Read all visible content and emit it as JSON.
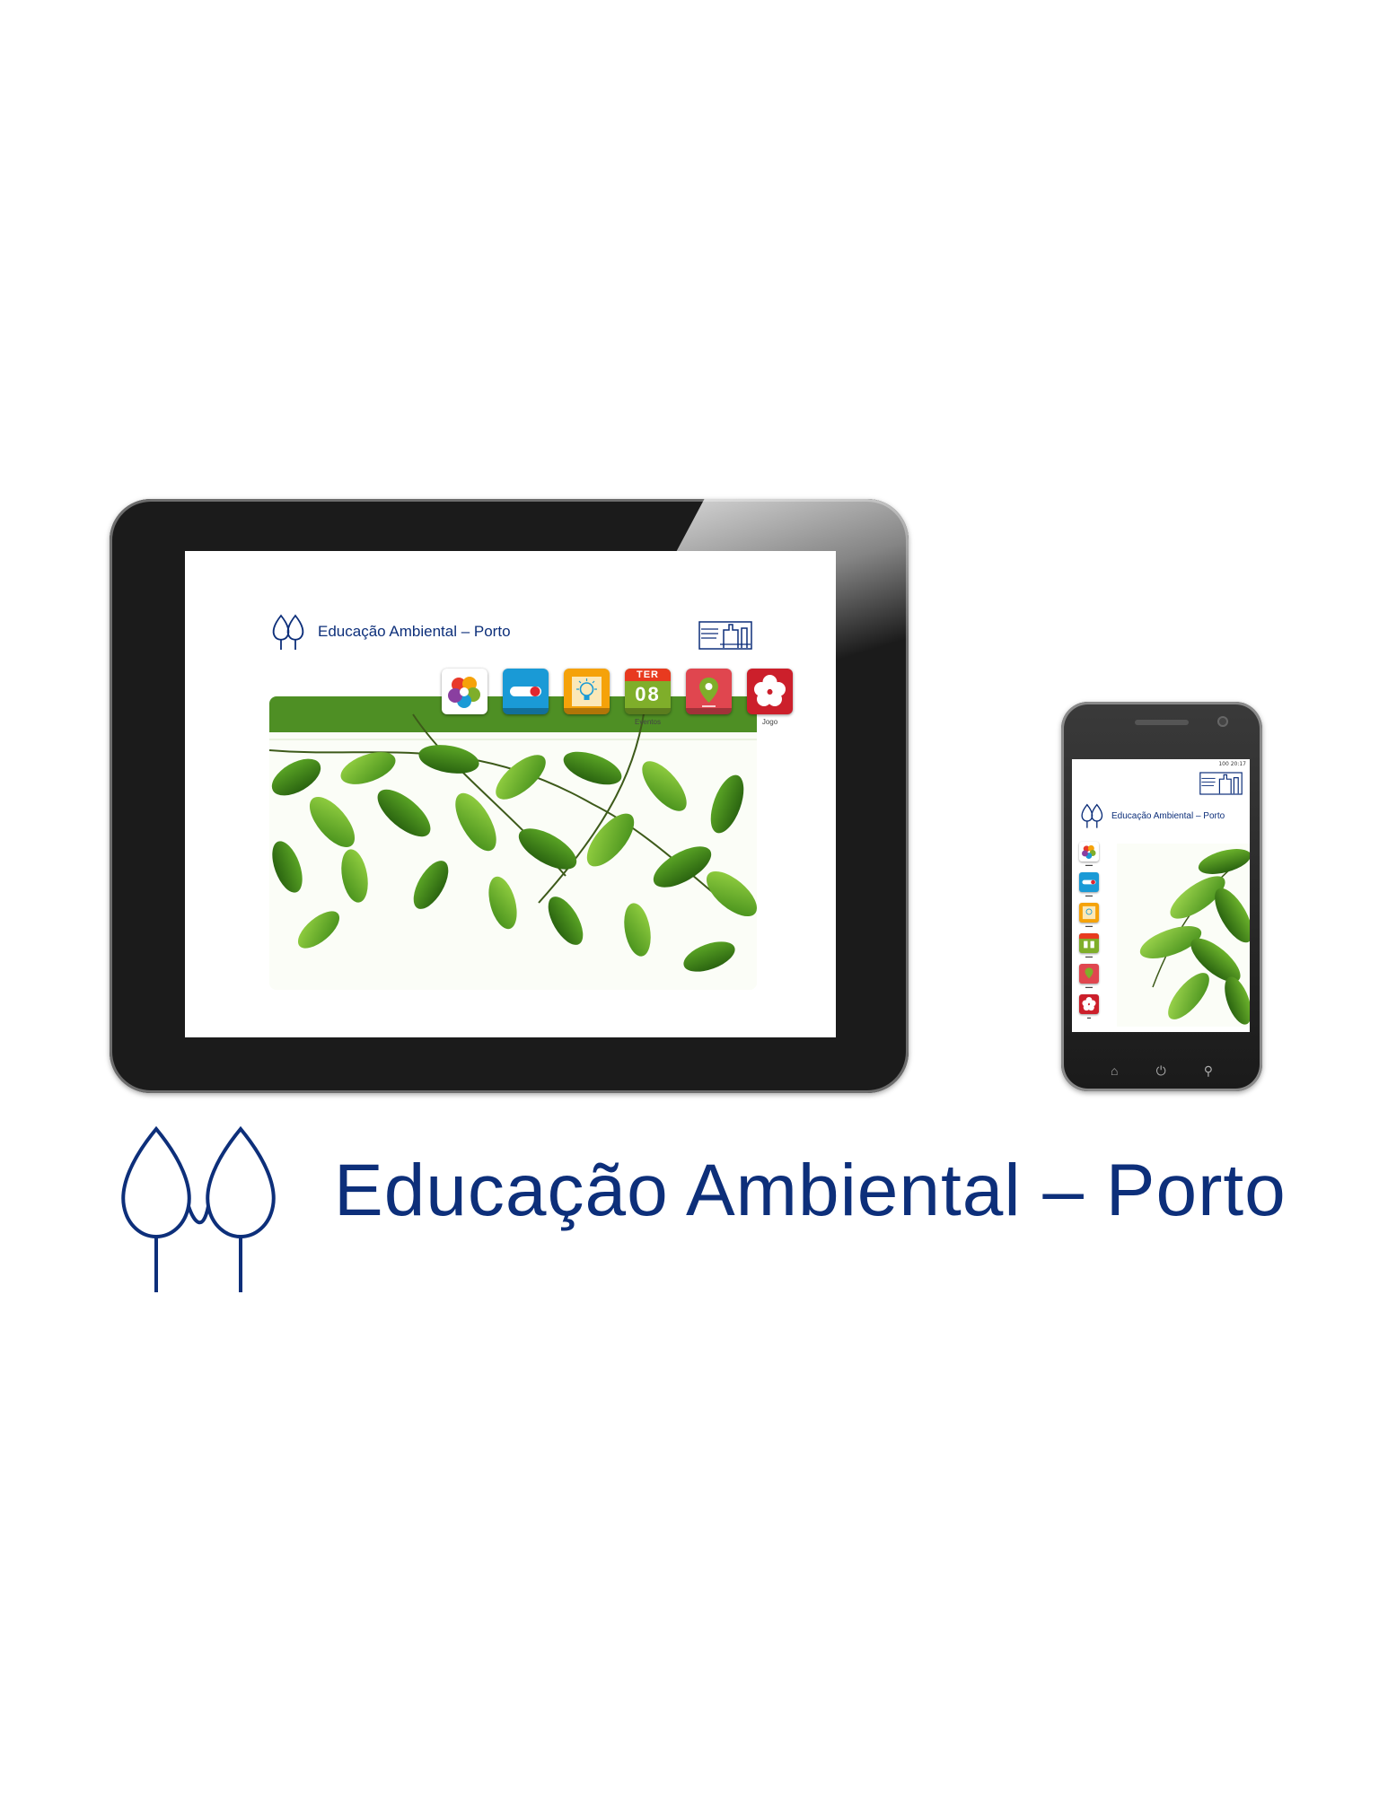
{
  "brand": {
    "title": "Educação Ambiental – Porto",
    "color": "#0d2f7a"
  },
  "tablet": {
    "header_title": "Educação Ambiental – Porto",
    "apps": [
      {
        "name": "monumentos",
        "label": "",
        "icon": "flower-logo-icon",
        "color": "#ffffff"
      },
      {
        "name": "toggle",
        "label": "",
        "icon": "toggle-icon",
        "color": "#1a9ad6"
      },
      {
        "name": "ideas",
        "label": "",
        "icon": "lightbulb-icon",
        "color": "#f5a20a"
      },
      {
        "name": "calendar",
        "label": "Eventos",
        "icon": "calendar-icon",
        "color": "#7fae2a",
        "cal_day": "TER",
        "cal_num": "08"
      },
      {
        "name": "map",
        "label": "",
        "icon": "map-pin-icon",
        "color": "#e0464f"
      },
      {
        "name": "game",
        "label": "Jogo",
        "icon": "hibiscus-icon",
        "color": "#cc1f2b"
      }
    ]
  },
  "phone": {
    "header_title": "Educação Ambiental – Porto",
    "status": "100 20:17"
  },
  "colors": {
    "leaf_dark": "#2f6e12",
    "leaf_mid": "#4f9a1c",
    "leaf_light": "#8ccf3a"
  }
}
